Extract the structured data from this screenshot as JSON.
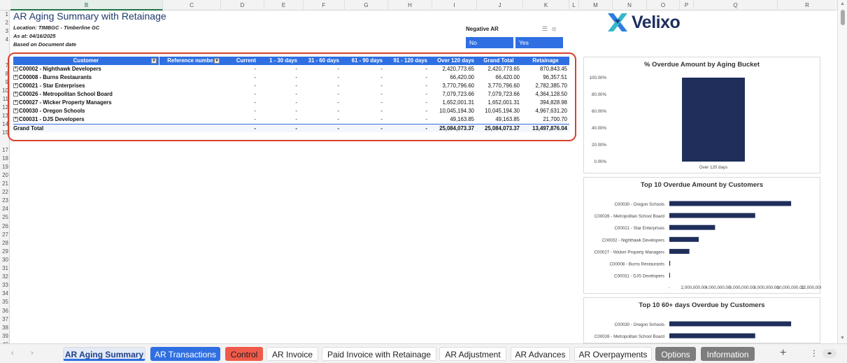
{
  "sheet": {
    "columns": [
      "B",
      "C",
      "D",
      "E",
      "F",
      "G",
      "H",
      "I",
      "J",
      "K",
      "L",
      "M",
      "N",
      "O",
      "P",
      "Q",
      "R"
    ],
    "selected_column": "B",
    "rows": [
      "1",
      "2",
      "3",
      "4",
      "",
      "",
      "7",
      "8",
      "9",
      "10",
      "11",
      "12",
      "13",
      "14",
      "15",
      "",
      "17",
      "18",
      "19",
      "20",
      "21",
      "22",
      "23",
      "24",
      "25",
      "26",
      "27",
      "28",
      "29",
      "30",
      "31",
      "32",
      "33",
      "34",
      "35",
      "36",
      "37",
      "38",
      "39",
      "40"
    ]
  },
  "report": {
    "title": "AR Aging Summary with Retainage",
    "location": "Location: TIMBGC - Timberline GC",
    "as_at": "As at: 04/16/2025",
    "based_on": "Based on Document date"
  },
  "slicer": {
    "title": "Negative AR",
    "icons": "☰⦻",
    "options": [
      "No",
      "Yes"
    ]
  },
  "logo": {
    "name": "Velixo"
  },
  "pivot": {
    "headers": [
      "Customer",
      "Reference numbe",
      "Current",
      "1 - 30 days",
      "31 - 60 days",
      "61 - 90 days",
      "91 - 120 days",
      "Over 120 days",
      "Grand Total",
      "Retainage"
    ],
    "rows": [
      {
        "label": "C00002 - Nighthawk Developers",
        "current": "-",
        "d1_30": "-",
        "d31_60": "-",
        "d61_90": "-",
        "d91_120": "-",
        "over120": "2,420,773.65",
        "total": "2,420,773.65",
        "retainage": "870,843.45"
      },
      {
        "label": "C00008 - Burns Restaurants",
        "current": "-",
        "d1_30": "-",
        "d31_60": "-",
        "d61_90": "-",
        "d91_120": "-",
        "over120": "66,420.00",
        "total": "66,420.00",
        "retainage": "96,357.51"
      },
      {
        "label": "C00021 - Star Enterprises",
        "current": "-",
        "d1_30": "-",
        "d31_60": "-",
        "d61_90": "-",
        "d91_120": "-",
        "over120": "3,770,796.60",
        "total": "3,770,796.60",
        "retainage": "2,782,385.70"
      },
      {
        "label": "C00026 - Metropolitan School Board",
        "current": "-",
        "d1_30": "-",
        "d31_60": "-",
        "d61_90": "-",
        "d91_120": "-",
        "over120": "7,079,723.66",
        "total": "7,079,723.66",
        "retainage": "4,364,128.50"
      },
      {
        "label": "C00027 - Wicker Property Managers",
        "current": "-",
        "d1_30": "-",
        "d31_60": "-",
        "d61_90": "-",
        "d91_120": "-",
        "over120": "1,652,001.31",
        "total": "1,652,001.31",
        "retainage": "394,828.98"
      },
      {
        "label": "C00030 - Oregon Schools",
        "current": "-",
        "d1_30": "-",
        "d31_60": "-",
        "d61_90": "-",
        "d91_120": "-",
        "over120": "10,045,194.30",
        "total": "10,045,194.30",
        "retainage": "4,967,631.20"
      },
      {
        "label": "C00031 - DJS Developers",
        "current": "-",
        "d1_30": "-",
        "d31_60": "-",
        "d61_90": "-",
        "d91_120": "-",
        "over120": "49,163.85",
        "total": "49,163.85",
        "retainage": "21,700.70"
      }
    ],
    "total": {
      "label": "Grand Total",
      "current": "-",
      "d1_30": "-",
      "d31_60": "-",
      "d61_90": "-",
      "d91_120": "-",
      "over120": "25,084,073.37",
      "total": "25,084,073.37",
      "retainage": "13,497,876.04"
    }
  },
  "chart_data": [
    {
      "type": "bar",
      "title": "% Overdue Amount by Aging Bucket",
      "categories": [
        "Over 120 days"
      ],
      "values": [
        100
      ],
      "ylim": [
        0,
        100
      ],
      "yticks": [
        "0.00%",
        "20.00%",
        "40.00%",
        "60.00%",
        "80.00%",
        "100.00%"
      ],
      "color": "#1f2e5a",
      "grid": false
    },
    {
      "type": "bar",
      "orientation": "horizontal",
      "title": "Top 10 Overdue Amount by Customers",
      "categories": [
        "C00030 - Oregon Schools",
        "C00026 - Metropolitan School Board",
        "C00021 - Star Enterprises",
        "C00002 - Nighthawk Developers",
        "C00027 - Wicker Property Managers",
        "C00008 - Burns Restaurants",
        "C00031 - DJS Developers"
      ],
      "values": [
        10045194.3,
        7079723.66,
        3770796.6,
        2420773.65,
        1652001.31,
        66420.0,
        49163.85
      ],
      "xlim": [
        0,
        12000000
      ],
      "xticks": [
        "-",
        "2,000,000.00",
        "4,000,000.00",
        "6,000,000.00",
        "8,000,000.00",
        "10,000,000.00",
        "12,000,000.00"
      ],
      "color": "#1f2e5a"
    },
    {
      "type": "bar",
      "orientation": "horizontal",
      "title": "Top 10 60+ days Overdue by Customers",
      "categories": [
        "C00030 - Oregon Schools",
        "C00026 - Metropolitan School Board"
      ],
      "values": [
        10045194.3,
        7079723.66
      ],
      "xlim": [
        0,
        12000000
      ],
      "color": "#1f2e5a"
    }
  ],
  "tabs": [
    {
      "label": "AR Aging Summary",
      "style": "active"
    },
    {
      "label": "AR Transactions",
      "style": "blue"
    },
    {
      "label": "Control",
      "style": "red"
    },
    {
      "label": "AR Invoice",
      "style": "plain"
    },
    {
      "label": "Paid Invoice with Retainage",
      "style": "plain"
    },
    {
      "label": "AR Adjustment",
      "style": "plain"
    },
    {
      "label": "AR Advances",
      "style": "plain"
    },
    {
      "label": "AR Overpayments",
      "style": "plain"
    },
    {
      "label": "Options",
      "style": "gray"
    },
    {
      "label": "Information",
      "style": "gray"
    }
  ],
  "tabbar": {
    "add": "+",
    "more": "⋮",
    "prev": "‹",
    "next": "›",
    "scroll": "◂▸"
  }
}
